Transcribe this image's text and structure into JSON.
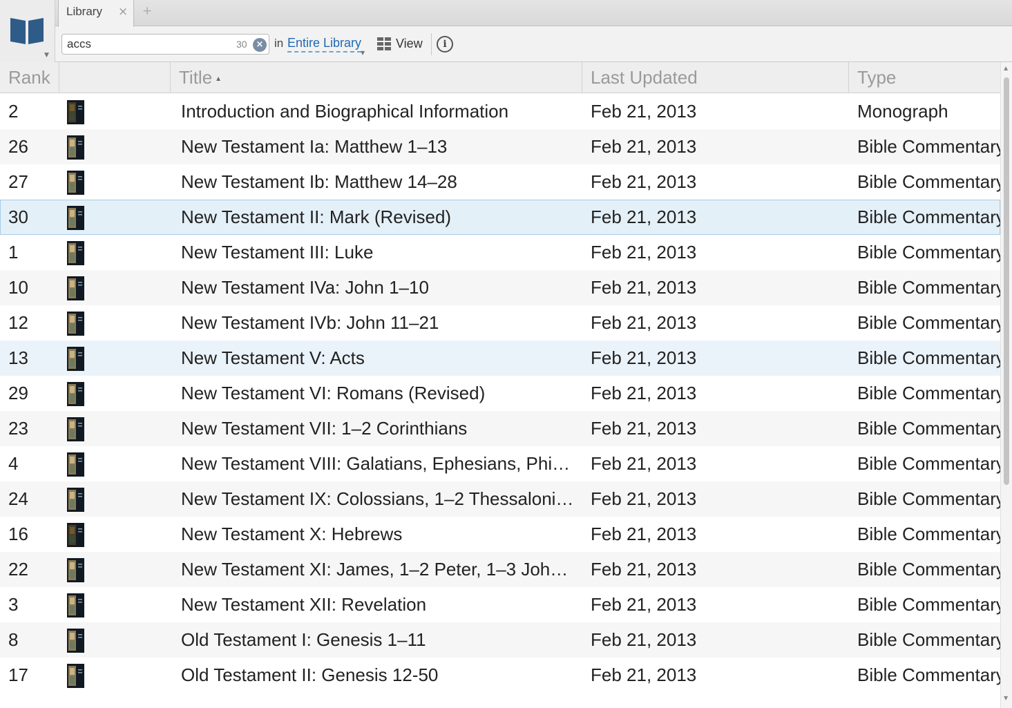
{
  "colors": {
    "accent_link": "#1f69b3",
    "selected_row": "#e4f0f8",
    "header_bg": "#eeeeee",
    "logo_blue": "#2e5b87"
  },
  "app": {
    "logo_icon": "open-book-icon",
    "tabs": [
      {
        "label": "Library",
        "close_glyph": "×"
      }
    ],
    "add_tab_glyph": "+"
  },
  "search": {
    "value": "accs",
    "result_count": "30",
    "clear_icon": "clear-circle-icon",
    "scope_prefix": "in",
    "scope_label": "Entire Library"
  },
  "toolbar": {
    "view_label": "View",
    "view_icon": "grid-icon",
    "info_icon": "info-icon",
    "info_glyph": "i"
  },
  "table": {
    "columns": [
      "Rank",
      "",
      "Title",
      "Last Updated",
      "Type"
    ],
    "sort_indicator": "▲",
    "rows": [
      {
        "rank": "2",
        "title": "Introduction and Biographical Information",
        "updated": "Feb 21, 2013",
        "type": "Monograph",
        "cover": "dark"
      },
      {
        "rank": "26",
        "title": "New Testament Ia: Matthew 1–13",
        "updated": "Feb 21, 2013",
        "type": "Bible Commentary",
        "cover": "std"
      },
      {
        "rank": "27",
        "title": "New Testament Ib: Matthew 14–28",
        "updated": "Feb 21, 2013",
        "type": "Bible Commentary",
        "cover": "std"
      },
      {
        "rank": "30",
        "title": "New Testament II: Mark (Revised)",
        "updated": "Feb 21, 2013",
        "type": "Bible Commentary",
        "cover": "std",
        "state": "selected"
      },
      {
        "rank": "1",
        "title": "New Testament III: Luke",
        "updated": "Feb 21, 2013",
        "type": "Bible Commentary",
        "cover": "std"
      },
      {
        "rank": "10",
        "title": "New Testament IVa: John 1–10",
        "updated": "Feb 21, 2013",
        "type": "Bible Commentary",
        "cover": "std"
      },
      {
        "rank": "12",
        "title": "New Testament IVb: John 11–21",
        "updated": "Feb 21, 2013",
        "type": "Bible Commentary",
        "cover": "std"
      },
      {
        "rank": "13",
        "title": "New Testament V: Acts",
        "updated": "Feb 21, 2013",
        "type": "Bible Commentary",
        "cover": "std",
        "state": "hover"
      },
      {
        "rank": "29",
        "title": "New Testament VI: Romans (Revised)",
        "updated": "Feb 21, 2013",
        "type": "Bible Commentary",
        "cover": "std"
      },
      {
        "rank": "23",
        "title": "New Testament VII: 1–2 Corinthians",
        "updated": "Feb 21, 2013",
        "type": "Bible Commentary",
        "cover": "std"
      },
      {
        "rank": "4",
        "title": "New Testament VIII: Galatians, Ephesians, Phi…",
        "updated": "Feb 21, 2013",
        "type": "Bible Commentary",
        "cover": "std"
      },
      {
        "rank": "24",
        "title": "New Testament IX: Colossians, 1–2 Thessaloni…",
        "updated": "Feb 21, 2013",
        "type": "Bible Commentary",
        "cover": "std"
      },
      {
        "rank": "16",
        "title": "New Testament X: Hebrews",
        "updated": "Feb 21, 2013",
        "type": "Bible Commentary",
        "cover": "dark"
      },
      {
        "rank": "22",
        "title": "New Testament XI: James, 1–2 Peter, 1–3 Joh…",
        "updated": "Feb 21, 2013",
        "type": "Bible Commentary",
        "cover": "std"
      },
      {
        "rank": "3",
        "title": "New Testament XII: Revelation",
        "updated": "Feb 21, 2013",
        "type": "Bible Commentary",
        "cover": "std"
      },
      {
        "rank": "8",
        "title": "Old Testament I: Genesis 1–11",
        "updated": "Feb 21, 2013",
        "type": "Bible Commentary",
        "cover": "std"
      },
      {
        "rank": "17",
        "title": "Old Testament II: Genesis 12-50",
        "updated": "Feb 21, 2013",
        "type": "Bible Commentary",
        "cover": "std"
      }
    ]
  },
  "scrollbar": {
    "up_glyph": "▲",
    "down_glyph": "▼"
  }
}
